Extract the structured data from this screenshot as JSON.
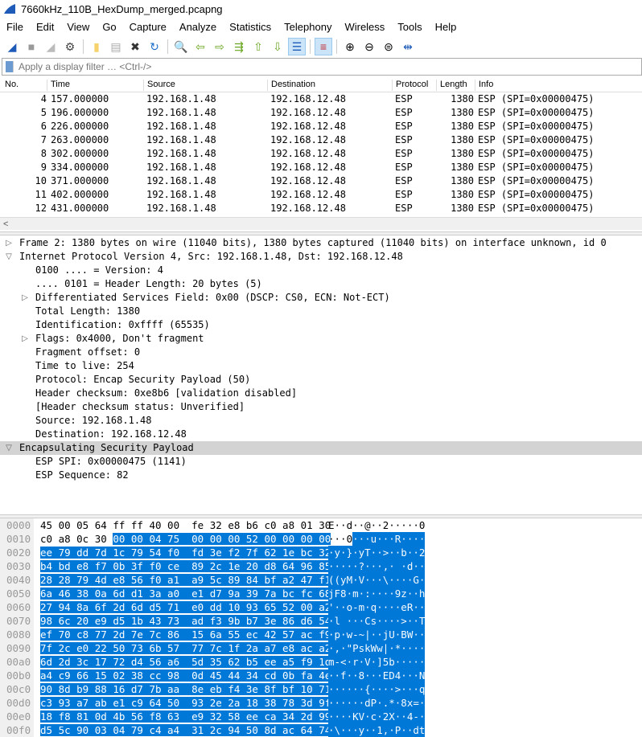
{
  "window": {
    "title": "7660kHz_110B_HexDump_merged.pcapng"
  },
  "menu": [
    "File",
    "Edit",
    "View",
    "Go",
    "Capture",
    "Analyze",
    "Statistics",
    "Telephony",
    "Wireless",
    "Tools",
    "Help"
  ],
  "toolbar": [
    {
      "icon": "shark-fin-start-icon",
      "glyph": "◢",
      "color": "#1e5bb8"
    },
    {
      "icon": "stop-icon",
      "glyph": "■",
      "color": "#999"
    },
    {
      "icon": "restart-icon",
      "glyph": "◢",
      "color": "#bbb"
    },
    {
      "icon": "options-gear-icon",
      "glyph": "⚙",
      "color": "#444"
    },
    {
      "sep": true
    },
    {
      "icon": "open-folder-icon",
      "glyph": "▮",
      "color": "#f5d26b"
    },
    {
      "icon": "save-icon",
      "glyph": "▤",
      "color": "#aaa"
    },
    {
      "icon": "close-file-icon",
      "glyph": "✖",
      "color": "#333"
    },
    {
      "icon": "reload-icon",
      "glyph": "↻",
      "color": "#1e6fc9"
    },
    {
      "sep": true
    },
    {
      "icon": "find-icon",
      "glyph": "🔍",
      "color": "#000"
    },
    {
      "icon": "back-icon",
      "glyph": "⇦",
      "color": "#6aa621"
    },
    {
      "icon": "forward-icon",
      "glyph": "⇨",
      "color": "#6aa621"
    },
    {
      "icon": "go-to-packet-icon",
      "glyph": "⇶",
      "color": "#6aa621"
    },
    {
      "icon": "first-packet-icon",
      "glyph": "⇧",
      "color": "#6aa621"
    },
    {
      "icon": "last-packet-icon",
      "glyph": "⇩",
      "color": "#6aa621"
    },
    {
      "icon": "autoscroll-icon",
      "glyph": "☰",
      "color": "#1e5bb8",
      "on": true
    },
    {
      "sep": true
    },
    {
      "icon": "colorize-icon",
      "glyph": "≡",
      "color": "#c0262d",
      "on": true
    },
    {
      "sep": true
    },
    {
      "icon": "zoom-in-icon",
      "glyph": "⊕",
      "color": "#000"
    },
    {
      "icon": "zoom-out-icon",
      "glyph": "⊖",
      "color": "#000"
    },
    {
      "icon": "zoom-reset-icon",
      "glyph": "⊜",
      "color": "#000"
    },
    {
      "icon": "resize-columns-icon",
      "glyph": "⇹",
      "color": "#1e5bb8"
    }
  ],
  "filter": {
    "placeholder": "Apply a display filter … <Ctrl-/>"
  },
  "packet_list": {
    "columns": [
      "No.",
      "Time",
      "Source",
      "Destination",
      "Protocol",
      "Length",
      "Info"
    ],
    "rows": [
      [
        "4",
        "157.000000",
        "192.168.1.48",
        "192.168.12.48",
        "ESP",
        "1380",
        "ESP (SPI=0x00000475)"
      ],
      [
        "5",
        "196.000000",
        "192.168.1.48",
        "192.168.12.48",
        "ESP",
        "1380",
        "ESP (SPI=0x00000475)"
      ],
      [
        "6",
        "226.000000",
        "192.168.1.48",
        "192.168.12.48",
        "ESP",
        "1380",
        "ESP (SPI=0x00000475)"
      ],
      [
        "7",
        "263.000000",
        "192.168.1.48",
        "192.168.12.48",
        "ESP",
        "1380",
        "ESP (SPI=0x00000475)"
      ],
      [
        "8",
        "302.000000",
        "192.168.1.48",
        "192.168.12.48",
        "ESP",
        "1380",
        "ESP (SPI=0x00000475)"
      ],
      [
        "9",
        "334.000000",
        "192.168.1.48",
        "192.168.12.48",
        "ESP",
        "1380",
        "ESP (SPI=0x00000475)"
      ],
      [
        "10",
        "371.000000",
        "192.168.1.48",
        "192.168.12.48",
        "ESP",
        "1380",
        "ESP (SPI=0x00000475)"
      ],
      [
        "11",
        "402.000000",
        "192.168.1.48",
        "192.168.12.48",
        "ESP",
        "1380",
        "ESP (SPI=0x00000475)"
      ],
      [
        "12",
        "431.000000",
        "192.168.1.48",
        "192.168.12.48",
        "ESP",
        "1380",
        "ESP (SPI=0x00000475)"
      ]
    ]
  },
  "details": [
    {
      "text": "Frame 2: 1380 bytes on wire (11040 bits), 1380 bytes captured (11040 bits) on interface unknown, id 0",
      "level": 0,
      "arrow": "›"
    },
    {
      "text": "Internet Protocol Version 4, Src: 192.168.1.48, Dst: 192.168.12.48",
      "level": 0,
      "arrow": "⌄"
    },
    {
      "text": "0100 .... = Version: 4",
      "level": 1
    },
    {
      "text": ".... 0101 = Header Length: 20 bytes (5)",
      "level": 1
    },
    {
      "text": "Differentiated Services Field: 0x00 (DSCP: CS0, ECN: Not-ECT)",
      "level": 1,
      "arrow": "›"
    },
    {
      "text": "Total Length: 1380",
      "level": 1
    },
    {
      "text": "Identification: 0xffff (65535)",
      "level": 1
    },
    {
      "text": "Flags: 0x4000, Don't fragment",
      "level": 1,
      "arrow": "›"
    },
    {
      "text": "Fragment offset: 0",
      "level": 1
    },
    {
      "text": "Time to live: 254",
      "level": 1
    },
    {
      "text": "Protocol: Encap Security Payload (50)",
      "level": 1
    },
    {
      "text": "Header checksum: 0xe8b6 [validation disabled]",
      "level": 1
    },
    {
      "text": "[Header checksum status: Unverified]",
      "level": 1
    },
    {
      "text": "Source: 192.168.1.48",
      "level": 1
    },
    {
      "text": "Destination: 192.168.12.48",
      "level": 1
    },
    {
      "text": "Encapsulating Security Payload",
      "level": 0,
      "arrow": "⌄",
      "selected": true
    },
    {
      "text": "ESP SPI: 0x00000475 (1141)",
      "level": 1
    },
    {
      "text": "ESP Sequence: 82",
      "level": 1
    }
  ],
  "hex": {
    "selection_start_byte": 20,
    "selection_color": "#0078d7",
    "rows": [
      {
        "off": "0000",
        "bytes": "45 00 05 64 ff ff 40 00 fe 32 e8 b6 c0 a8 01 30",
        "ascii": "E··d··@··2·····0"
      },
      {
        "off": "0010",
        "bytes": "c0 a8 0c 30 00 00 04 75 00 00 00 52 00 00 00 00",
        "ascii": "···0···u···R····"
      },
      {
        "off": "0020",
        "bytes": "ee 79 dd 7d 1c 79 54 f0 fd 3e f2 7f 62 1e bc 32",
        "ascii": "·y·}·yT··>··b··2"
      },
      {
        "off": "0030",
        "bytes": "b4 bd e8 f7 0b 3f f0 ce 89 2c 1e 20 d8 64 96 85",
        "ascii": "·····?···,· ·d··"
      },
      {
        "off": "0040",
        "bytes": "28 28 79 4d e8 56 f0 a1 a9 5c 89 84 bf a2 47 f1",
        "ascii": "((yM·V···\\····G·"
      },
      {
        "off": "0050",
        "bytes": "6a 46 38 0a 6d d1 3a a0 e1 d7 9a 39 7a bc fc 68",
        "ascii": "jF8·m·:····9z··h"
      },
      {
        "off": "0060",
        "bytes": "27 94 8a 6f 2d 6d d5 71 e0 dd 10 93 65 52 00 a2",
        "ascii": "'··o-m·q····eR··"
      },
      {
        "off": "0070",
        "bytes": "98 6c 20 e9 d5 1b 43 73 ad f3 9b b7 3e 86 d6 54",
        "ascii": "·l ···Cs····>··T"
      },
      {
        "off": "0080",
        "bytes": "ef 70 c8 77 2d 7e 7c 86 15 6a 55 ec 42 57 ac f9",
        "ascii": "·p·w-~|··jU·BW··"
      },
      {
        "off": "0090",
        "bytes": "7f 2c e0 22 50 73 6b 57 77 7c 1f 2a a7 e8 ac a2",
        "ascii": "·,·\"PskWw|·*····"
      },
      {
        "off": "00a0",
        "bytes": "6d 2d 3c 17 72 d4 56 a6 5d 35 62 b5 ee a5 f9 1d",
        "ascii": "m-<·r·V·]5b·····"
      },
      {
        "off": "00b0",
        "bytes": "a4 c9 66 15 02 38 cc 98 0d 45 44 34 cd 0b fa 4e",
        "ascii": "··f··8···ED4···N"
      },
      {
        "off": "00c0",
        "bytes": "90 8d b9 88 16 d7 7b aa 8e eb f4 3e 8f bf 10 71",
        "ascii": "······{····>···q"
      },
      {
        "off": "00d0",
        "bytes": "c3 93 a7 ab e1 c9 64 50 93 2e 2a 18 38 78 3d 9f",
        "ascii": "······dP·.*·8x=·"
      },
      {
        "off": "00e0",
        "bytes": "18 f8 81 0d 4b 56 f8 63 e9 32 58 ee ca 34 2d 99",
        "ascii": "····KV·c·2X··4-·"
      },
      {
        "off": "00f0",
        "bytes": "d5 5c 90 03 04 79 c4 a4 31 2c 94 50 8d ac 64 74",
        "ascii": "·\\···y··1,·P··dt"
      }
    ]
  }
}
